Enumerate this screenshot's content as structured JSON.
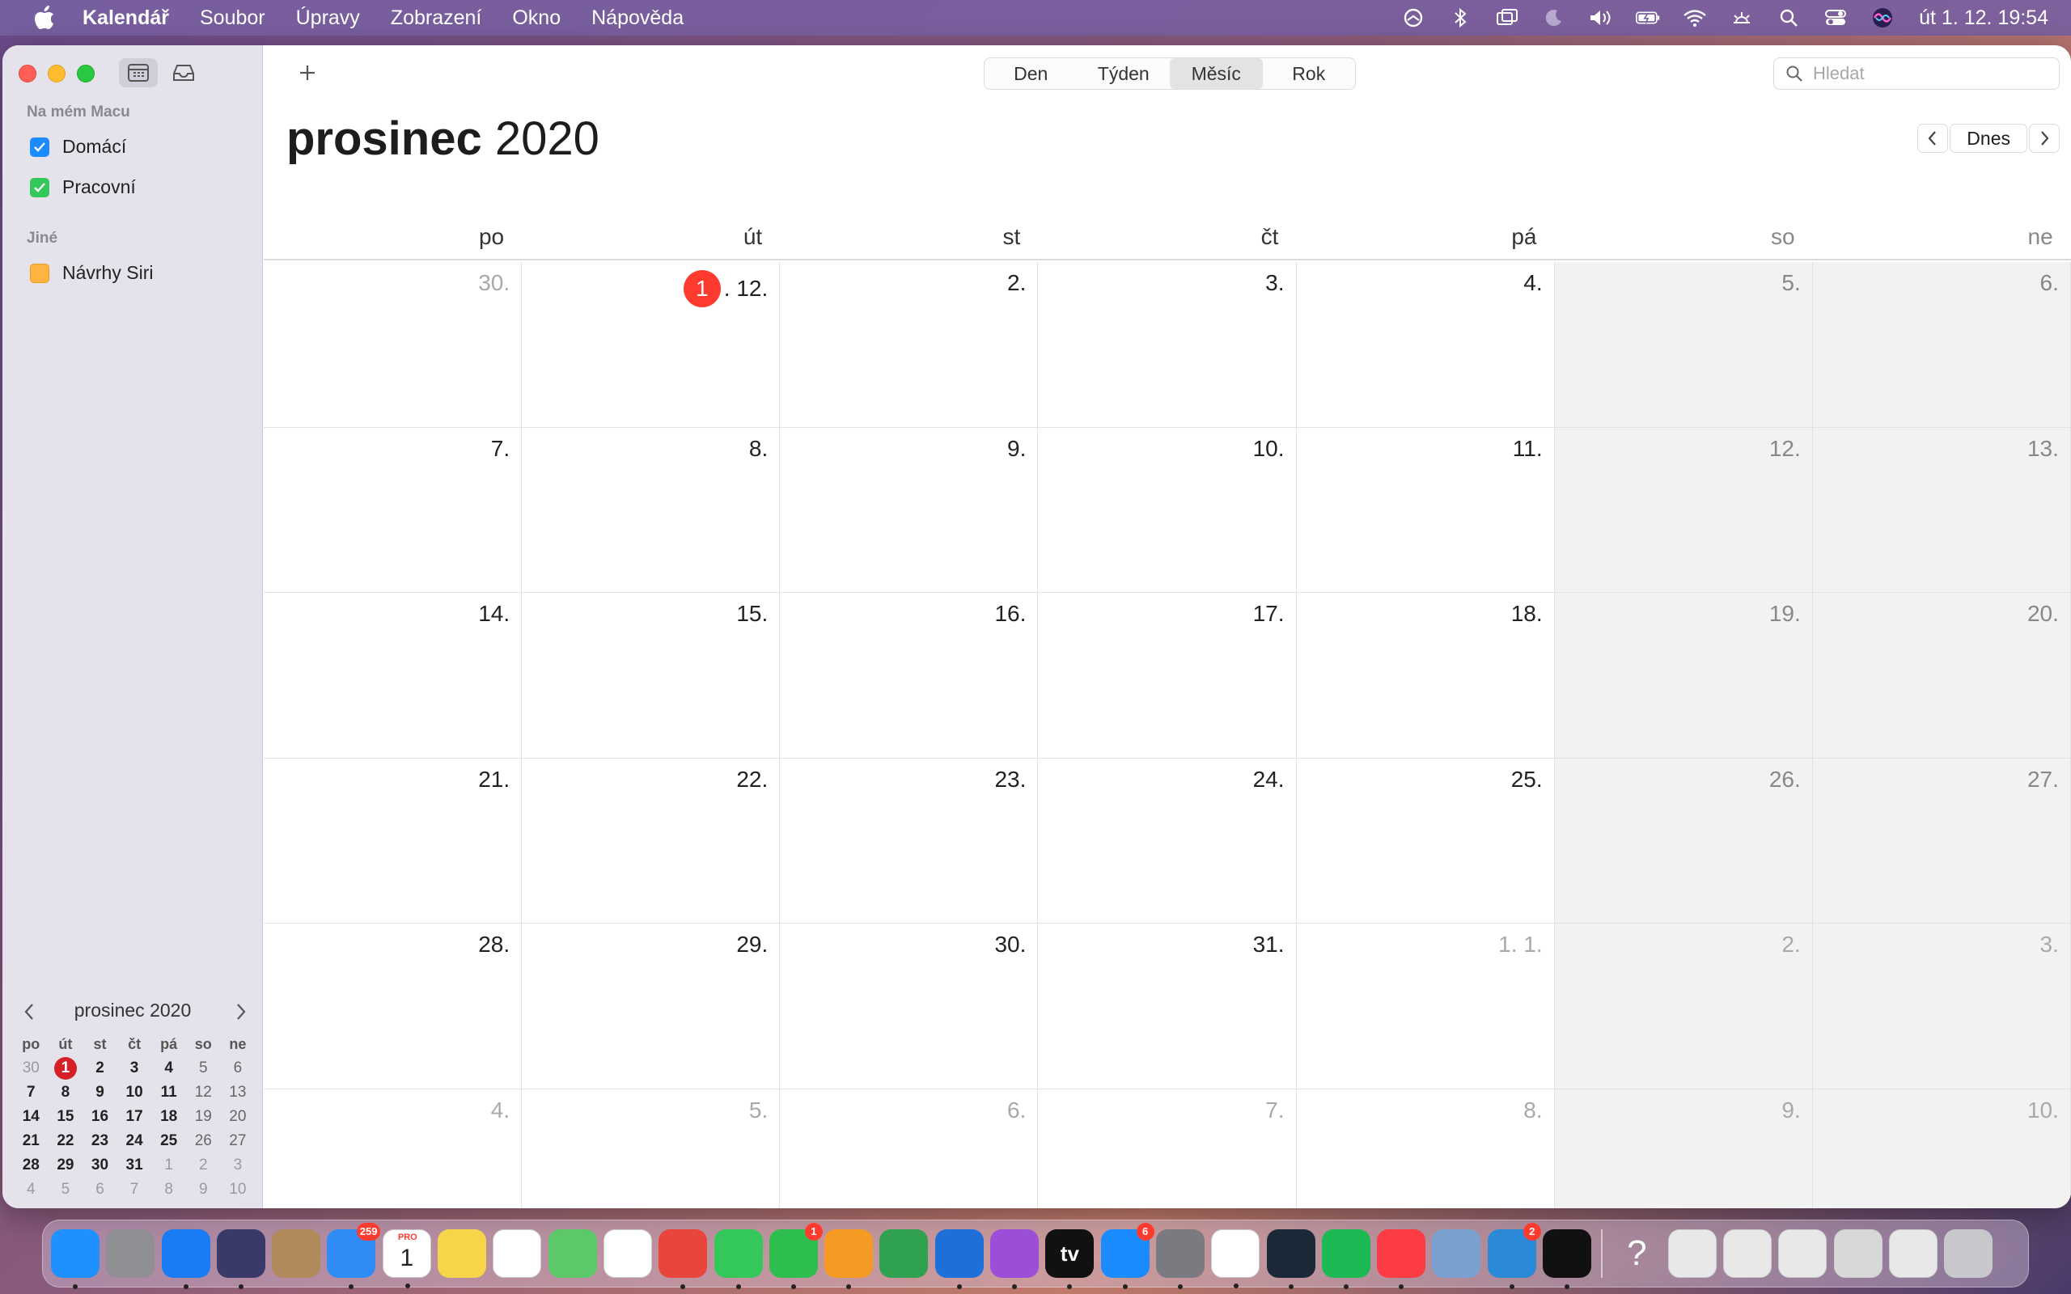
{
  "menubar": {
    "app_name": "Kalendář",
    "menus": [
      "Soubor",
      "Úpravy",
      "Zobrazení",
      "Okno",
      "Nápověda"
    ],
    "clock": "út 1. 12.  19:54"
  },
  "sidebar": {
    "section_mac": "Na mém Macu",
    "calendars": [
      {
        "label": "Domácí",
        "color": "#1a8cff",
        "checked": true
      },
      {
        "label": "Pracovní",
        "color": "#34c759",
        "checked": true
      }
    ],
    "section_other": "Jiné",
    "siri": {
      "label": "Návrhy Siri",
      "color": "#ffb340"
    }
  },
  "mini_calendar": {
    "title": "prosinec 2020",
    "weekdays": [
      "po",
      "út",
      "st",
      "čt",
      "pá",
      "so",
      "ne"
    ],
    "rows": [
      [
        "30",
        "1",
        "2",
        "3",
        "4",
        "5",
        "6"
      ],
      [
        "7",
        "8",
        "9",
        "10",
        "11",
        "12",
        "13"
      ],
      [
        "14",
        "15",
        "16",
        "17",
        "18",
        "19",
        "20"
      ],
      [
        "21",
        "22",
        "23",
        "24",
        "25",
        "26",
        "27"
      ],
      [
        "28",
        "29",
        "30",
        "31",
        "1",
        "2",
        "3"
      ],
      [
        "4",
        "5",
        "6",
        "7",
        "8",
        "9",
        "10"
      ]
    ]
  },
  "toolbar": {
    "views": [
      "Den",
      "Týden",
      "Měsíc",
      "Rok"
    ],
    "selected_view": "Měsíc",
    "search_placeholder": "Hledat",
    "today_label": "Dnes"
  },
  "month": {
    "name": "prosinec",
    "year": "2020",
    "weekdays": [
      "po",
      "út",
      "st",
      "čt",
      "pá",
      "so",
      "ne"
    ],
    "today_day": "1",
    "weeks": [
      [
        "30.",
        ". 12.",
        "2.",
        "3.",
        "4.",
        "5.",
        "6."
      ],
      [
        "7.",
        "8.",
        "9.",
        "10.",
        "11.",
        "12.",
        "13."
      ],
      [
        "14.",
        "15.",
        "16.",
        "17.",
        "18.",
        "19.",
        "20."
      ],
      [
        "21.",
        "22.",
        "23.",
        "24.",
        "25.",
        "26.",
        "27."
      ],
      [
        "28.",
        "29.",
        "30.",
        "31.",
        "1. 1.",
        "2.",
        "3."
      ],
      [
        "4.",
        "5.",
        "6.",
        "7.",
        "8.",
        "9.",
        "10."
      ]
    ]
  },
  "dock": {
    "apps": [
      {
        "name": "finder",
        "color": "#1e90ff"
      },
      {
        "name": "launchpad",
        "color": "#8e8e93"
      },
      {
        "name": "safari",
        "color": "#1a7cf5"
      },
      {
        "name": "siri",
        "color": "#3a3a6a"
      },
      {
        "name": "contacts",
        "color": "#b08a5a"
      },
      {
        "name": "mail",
        "color": "#2f8cf5",
        "badge": "259"
      },
      {
        "name": "calendar",
        "color": "#ffffff",
        "text": "1",
        "sub": "PRO"
      },
      {
        "name": "notes",
        "color": "#f7d548"
      },
      {
        "name": "reminders",
        "color": "#ffffff"
      },
      {
        "name": "maps",
        "color": "#5cc86a"
      },
      {
        "name": "photos",
        "color": "#ffffff"
      },
      {
        "name": "chrome",
        "color": "#e8453c"
      },
      {
        "name": "messages",
        "color": "#34c759"
      },
      {
        "name": "facetime",
        "color": "#2dbe4f",
        "badge": "1"
      },
      {
        "name": "pages",
        "color": "#f59a23"
      },
      {
        "name": "numbers",
        "color": "#30a14e"
      },
      {
        "name": "keynote",
        "color": "#1f6fd9"
      },
      {
        "name": "podcasts",
        "color": "#9b4fd9"
      },
      {
        "name": "apple-tv",
        "color": "#111111",
        "text": "tv"
      },
      {
        "name": "app-store",
        "color": "#1a8cff",
        "badge": "6"
      },
      {
        "name": "system-preferences",
        "color": "#7a7a80"
      },
      {
        "name": "home",
        "color": "#ffffff"
      },
      {
        "name": "steam",
        "color": "#1b2838"
      },
      {
        "name": "spotify",
        "color": "#1db954"
      },
      {
        "name": "music",
        "color": "#fc3c44"
      },
      {
        "name": "preview",
        "color": "#7aa0d0"
      },
      {
        "name": "cleaner",
        "color": "#2a8ad8",
        "badge": "2"
      },
      {
        "name": "scrivener",
        "color": "#111111"
      }
    ],
    "recent": [
      {
        "name": "help",
        "color": "transparent"
      },
      {
        "name": "document-1",
        "color": "#e8e8e8"
      },
      {
        "name": "document-2",
        "color": "#e8e8e8"
      },
      {
        "name": "document-3",
        "color": "#e8e8e8"
      },
      {
        "name": "document-4",
        "color": "#d8d8d8"
      },
      {
        "name": "document-5",
        "color": "#e8e8e8"
      },
      {
        "name": "trash",
        "color": "#c8c8cc"
      }
    ]
  }
}
